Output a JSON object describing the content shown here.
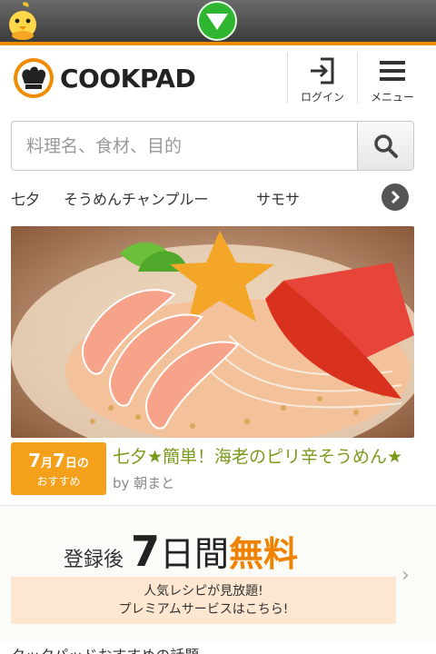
{
  "status_bar": {
    "chick_icon": "chick-mascot-icon",
    "down_icon": "green-down-arrow-icon"
  },
  "header": {
    "logo_text": "COOKPAD",
    "login_label": "ログイン",
    "menu_label": "メニュー"
  },
  "search": {
    "placeholder": "料理名、食材、目的"
  },
  "keywords": [
    "七夕",
    "そうめんチャンプルー",
    "サモサ"
  ],
  "feature": {
    "badge_month": "7",
    "badge_month_unit": "月",
    "badge_day": "7",
    "badge_day_unit": "日の",
    "badge_sub": "おすすめ",
    "title": "七夕★簡単！海老のピリ辛そうめん★",
    "author": "by 朝まと"
  },
  "premium": {
    "prefix": "登録後",
    "number": "7",
    "days": "日間",
    "free": "無料",
    "notice_line1": "人気レシピが見放題!",
    "notice_line2": "プレミアムサービスはこちら!"
  },
  "bottom_text": "クックパッドおすすめの話題",
  "colors": {
    "accent": "#f08c00",
    "title_green": "#7a9a1a",
    "badge": "#f5a01b"
  }
}
